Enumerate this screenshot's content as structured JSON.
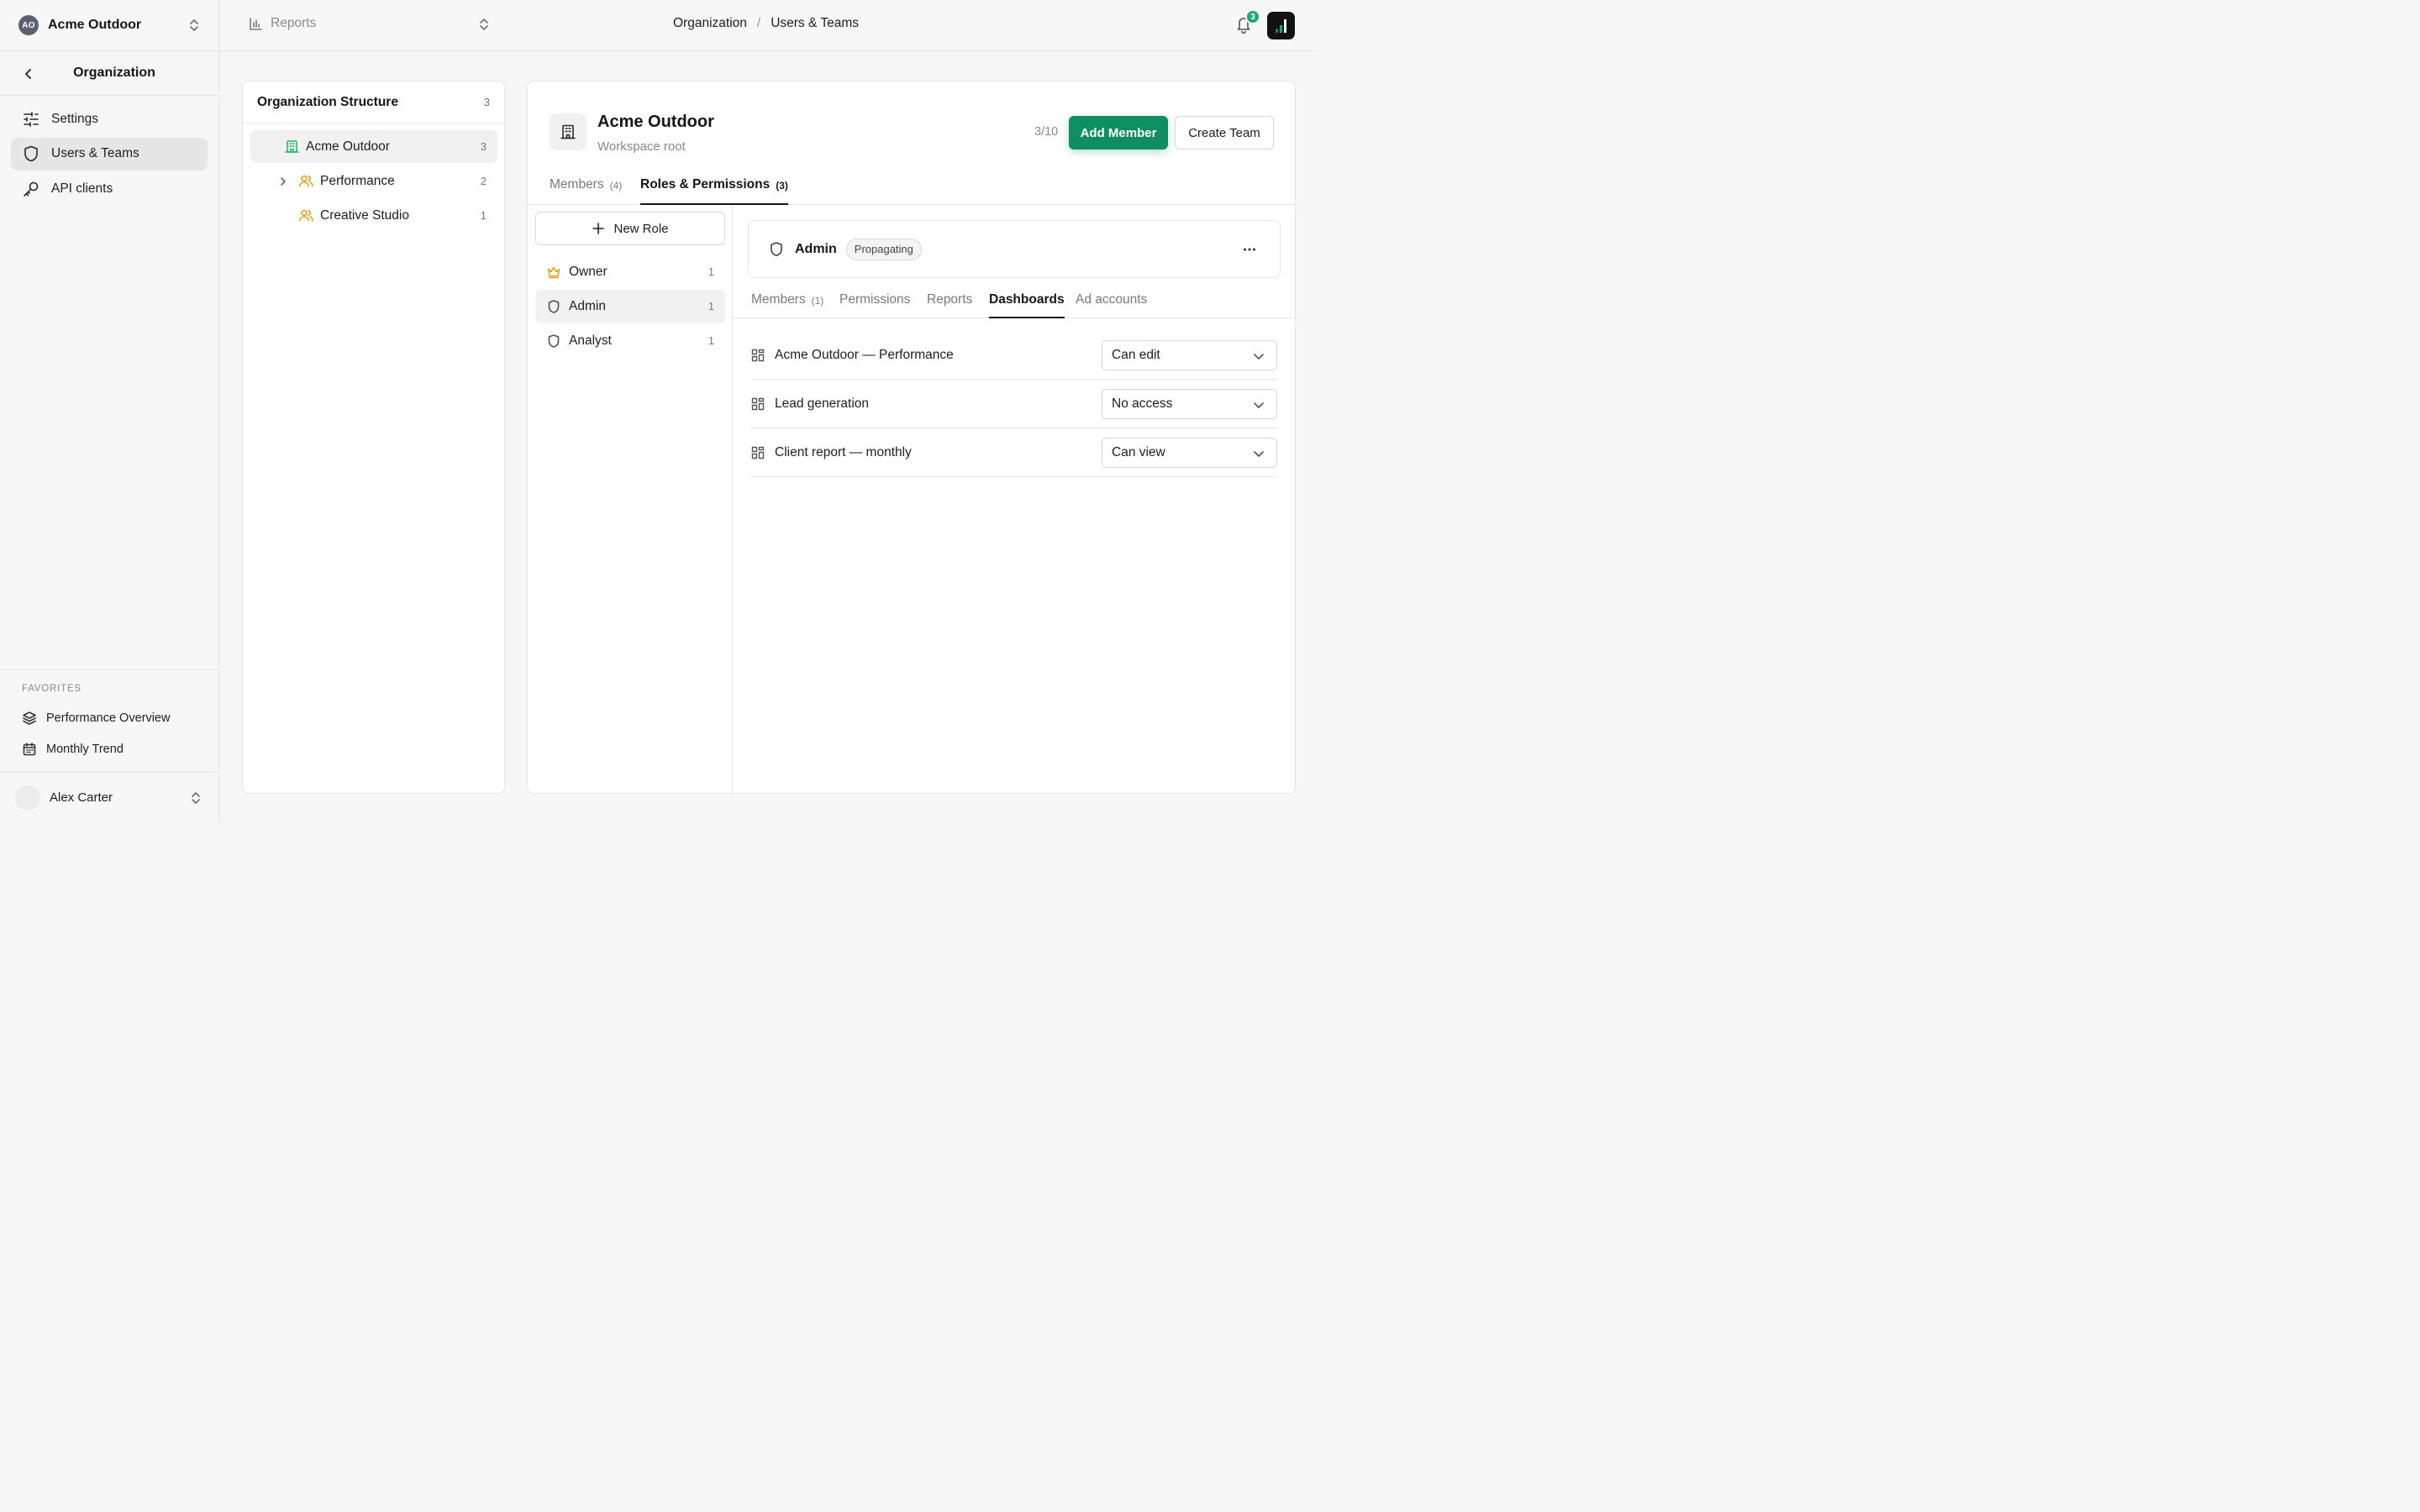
{
  "workspace": {
    "initials": "AO",
    "name": "Acme Outdoor"
  },
  "sidebar": {
    "back_title": "Organization",
    "items": [
      {
        "label": "Settings",
        "icon": "sliders-icon"
      },
      {
        "label": "Users & Teams",
        "icon": "shield-icon",
        "active": true
      },
      {
        "label": "API clients",
        "icon": "key-icon"
      }
    ],
    "favorites_heading": "FAVORITES",
    "favorites": [
      {
        "label": "Performance Overview",
        "icon": "layers-icon"
      },
      {
        "label": "Monthly Trend",
        "icon": "calendar-icon"
      }
    ],
    "user_name": "Alex Carter"
  },
  "topbar": {
    "report_label": "Reports",
    "breadcrumb": [
      "Organization",
      "Users & Teams"
    ],
    "breadcrumb_sep": "/",
    "notification_count": "3"
  },
  "org": {
    "title": "Organization Structure",
    "count": "3",
    "nodes": [
      {
        "label": "Acme Outdoor",
        "count": "3"
      },
      {
        "label": "Performance",
        "count": "2"
      },
      {
        "label": "Creative Studio",
        "count": "1"
      }
    ]
  },
  "entity": {
    "name": "Acme Outdoor",
    "subtitle": "Workspace root",
    "seats": "3/10",
    "add_member": "Add Member",
    "create_team": "Create Team"
  },
  "tabs": [
    {
      "label": "Members",
      "count": "(4)"
    },
    {
      "label": "Roles & Permissions",
      "count": "(3)",
      "active": true
    }
  ],
  "roles": {
    "new_role": "New Role",
    "items": [
      {
        "label": "Owner",
        "count": "1"
      },
      {
        "label": "Admin",
        "count": "1",
        "selected": true
      },
      {
        "label": "Analyst",
        "count": "1"
      }
    ]
  },
  "role_detail": {
    "name": "Admin",
    "badge": "Propagating",
    "subtabs": [
      {
        "label": "Members",
        "count": "(1)"
      },
      {
        "label": "Permissions"
      },
      {
        "label": "Reports"
      },
      {
        "label": "Dashboards",
        "active": true
      },
      {
        "label": "Ad accounts"
      }
    ],
    "dashboards": [
      {
        "name": "Acme Outdoor — Performance",
        "access": "Can edit"
      },
      {
        "name": "Lead generation",
        "access": "No access"
      },
      {
        "name": "Client report — monthly",
        "access": "Can view"
      }
    ]
  },
  "colors": {
    "accent": "#0f8f61",
    "badge_green": "#1fa971",
    "team_icon": "#e0a21b",
    "org_icon": "#2fb36f"
  }
}
